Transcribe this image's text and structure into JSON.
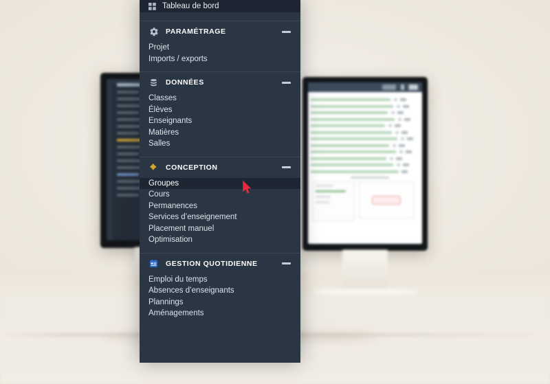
{
  "app": {
    "top_item": {
      "label": "Tableau de bord",
      "icon": "grid-icon"
    },
    "cursor": {
      "color": "#e8283c",
      "icon": "mouse-pointer-icon"
    }
  },
  "colors": {
    "panel_bg": "#2b3644",
    "panel_active": "#1d2632",
    "panel_divider": "#3a4654",
    "text": "#dde3e9",
    "heading": "#ffffff",
    "collapse": "#c7ced6",
    "page_bg": "#f2eee6",
    "icon_conception": "#d3a82a",
    "icon_gestion": "#2f6fd0",
    "icon_donnees": "#b9c2cb",
    "icon_parametrage": "#b9c2cb"
  },
  "menu": {
    "sections": [
      {
        "id": "parametrage",
        "title": "PARAMÉTRAGE",
        "icon": "gear-icon",
        "collapse_label": "—",
        "items": [
          {
            "label": "Projet",
            "active": false
          },
          {
            "label": "Imports / exports",
            "active": false
          }
        ]
      },
      {
        "id": "donnees",
        "title": "DONNÉES",
        "icon": "database-icon",
        "collapse_label": "—",
        "items": [
          {
            "label": "Classes",
            "active": false
          },
          {
            "label": "Élèves",
            "active": false
          },
          {
            "label": "Enseignants",
            "active": false
          },
          {
            "label": "Matières",
            "active": false
          },
          {
            "label": "Salles",
            "active": false
          }
        ]
      },
      {
        "id": "conception",
        "title": "CONCEPTION",
        "icon": "puzzle-icon",
        "collapse_label": "—",
        "items": [
          {
            "label": "Groupes",
            "active": true
          },
          {
            "label": "Cours",
            "active": false
          },
          {
            "label": "Permanences",
            "active": false
          },
          {
            "label": "Services d’enseignement",
            "active": false
          },
          {
            "label": "Placement manuel",
            "active": false
          },
          {
            "label": "Optimisation",
            "active": false
          }
        ]
      },
      {
        "id": "gestion-quotidienne",
        "title": "GESTION QUOTIDIENNE",
        "icon": "calendar-icon",
        "collapse_label": "—",
        "items": [
          {
            "label": "Emploi du temps",
            "active": false
          },
          {
            "label": "Absences d’enseignants",
            "active": false
          },
          {
            "label": "Plannings",
            "active": false
          },
          {
            "label": "Aménagements",
            "active": false
          }
        ]
      }
    ]
  }
}
